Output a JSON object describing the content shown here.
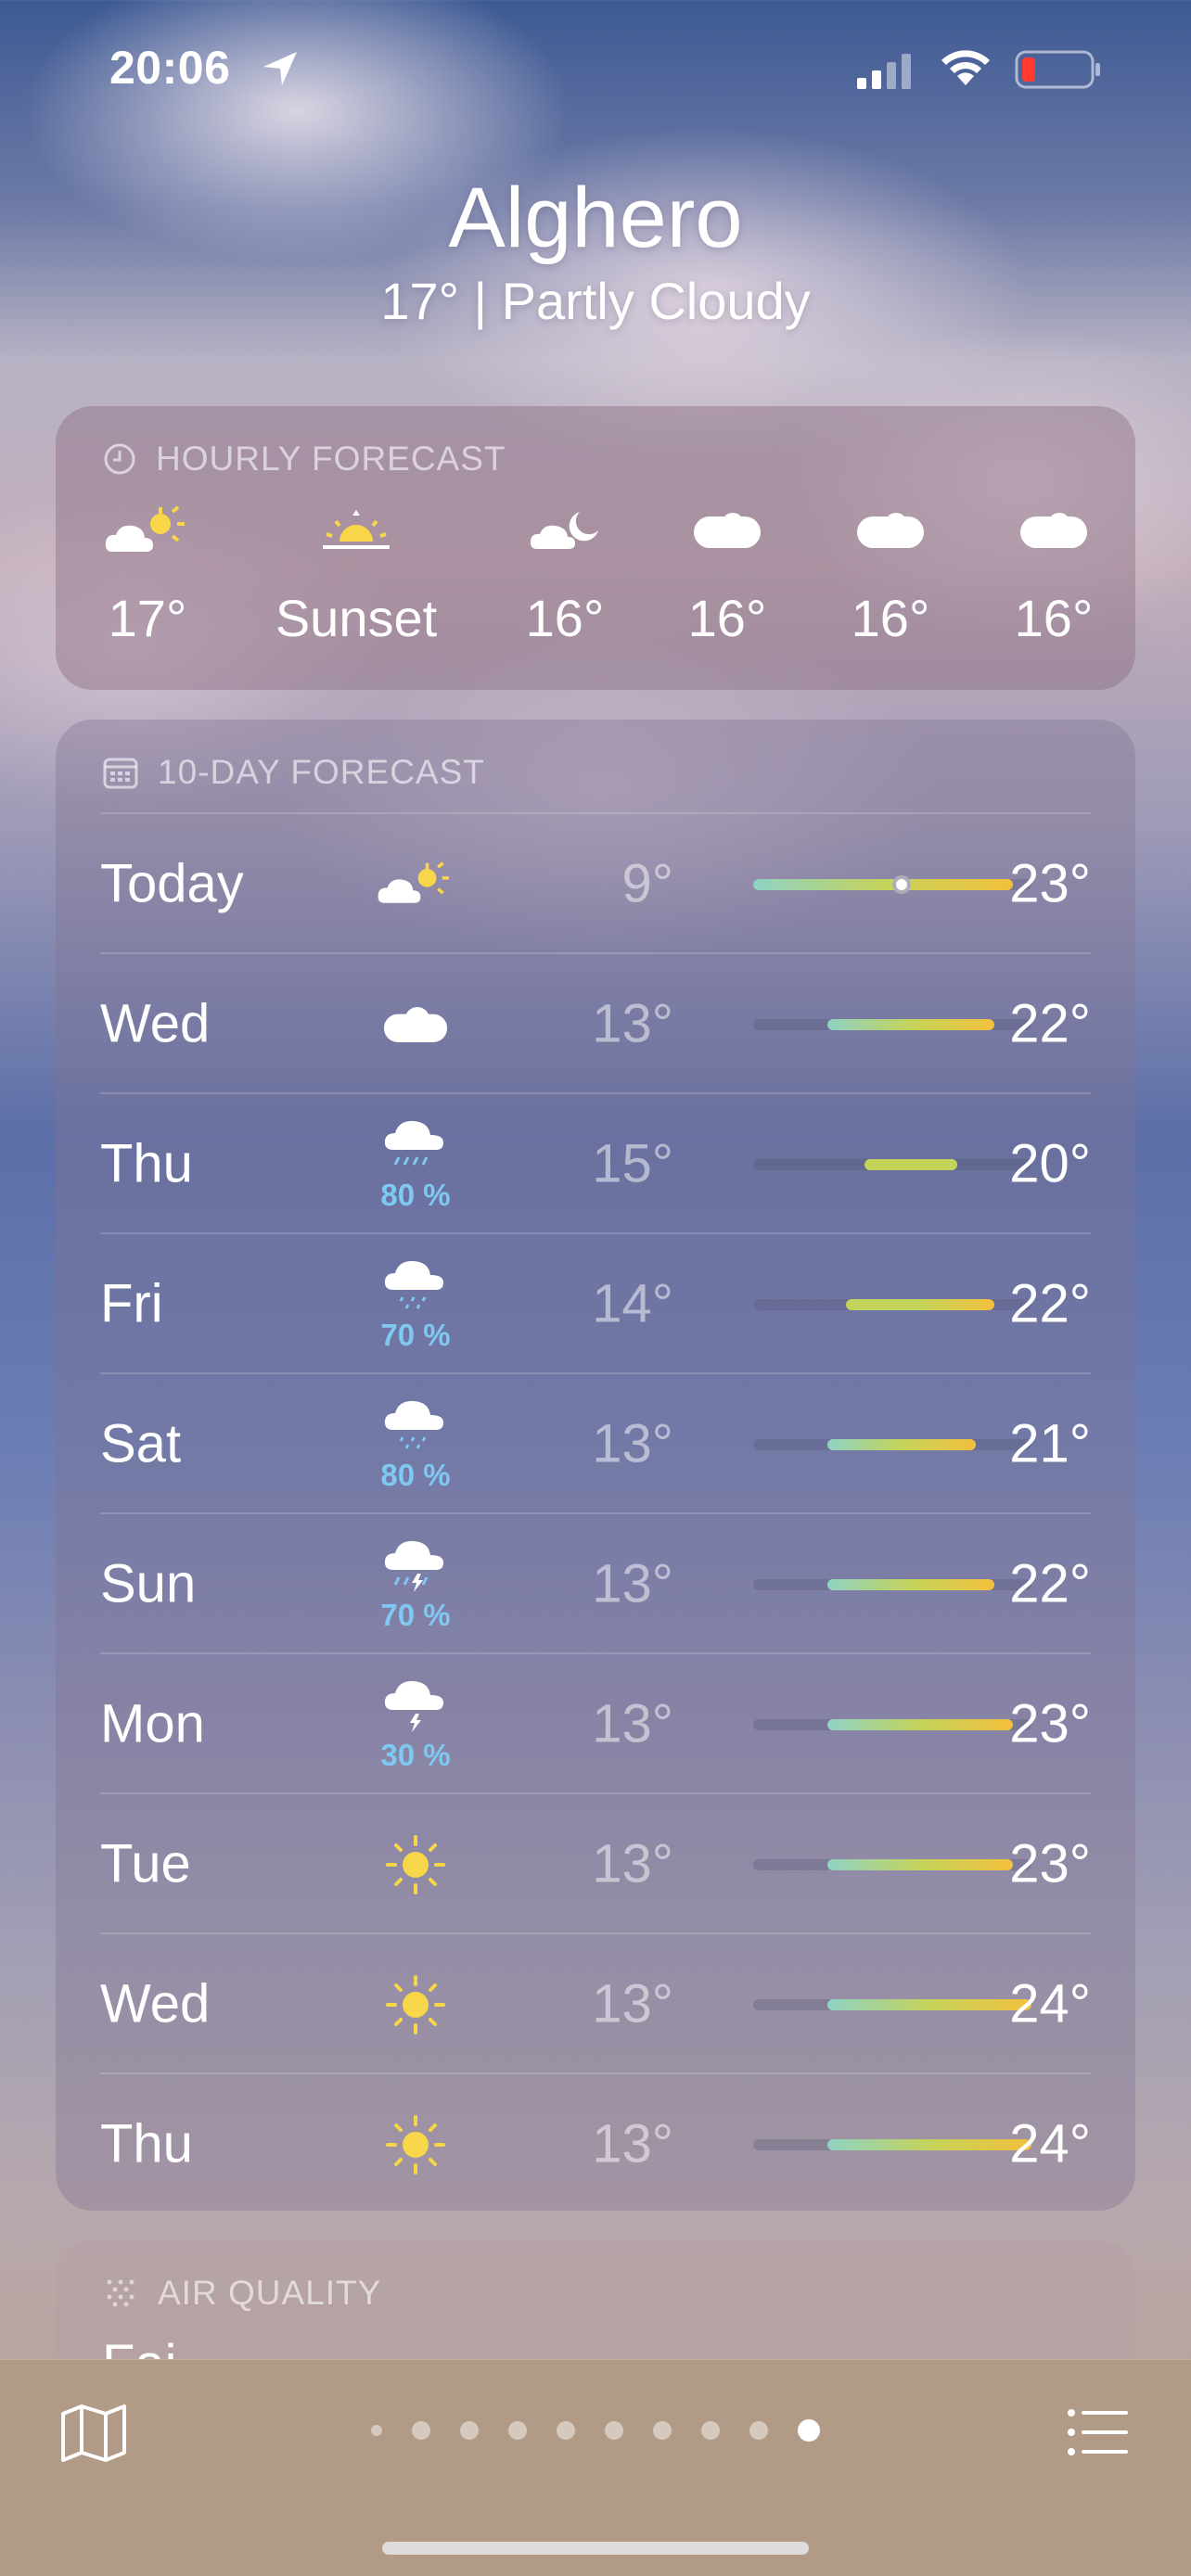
{
  "status_bar": {
    "time": "20:06"
  },
  "location": {
    "city": "Alghero",
    "summary": "17°  |  Partly Cloudy"
  },
  "hourly": {
    "title": "HOURLY FORECAST",
    "items": [
      {
        "temp": "17°",
        "icon": "partly-cloudy-day-icon"
      },
      {
        "temp": "Sunset",
        "icon": "sunset-icon"
      },
      {
        "temp": "16°",
        "icon": "partly-cloudy-night-icon"
      },
      {
        "temp": "16°",
        "icon": "cloud-icon"
      },
      {
        "temp": "16°",
        "icon": "cloud-icon"
      },
      {
        "temp": "16°",
        "icon": "cloud-icon"
      }
    ]
  },
  "daily": {
    "title": "10-DAY FORECAST",
    "range_min": 9,
    "range_max": 24,
    "days": [
      {
        "day": "Today",
        "icon": "partly-cloudy-day-icon",
        "precip": "",
        "low": "9°",
        "high": "23°",
        "low_v": 9,
        "high_v": 23,
        "current_v": 17
      },
      {
        "day": "Wed",
        "icon": "cloud-icon",
        "precip": "",
        "low": "13°",
        "high": "22°",
        "low_v": 13,
        "high_v": 22
      },
      {
        "day": "Thu",
        "icon": "cloud-rain-icon",
        "precip": "80 %",
        "low": "15°",
        "high": "20°",
        "low_v": 15,
        "high_v": 20
      },
      {
        "day": "Fri",
        "icon": "cloud-drizzle-icon",
        "precip": "70 %",
        "low": "14°",
        "high": "22°",
        "low_v": 14,
        "high_v": 22
      },
      {
        "day": "Sat",
        "icon": "cloud-drizzle-icon",
        "precip": "80 %",
        "low": "13°",
        "high": "21°",
        "low_v": 13,
        "high_v": 21
      },
      {
        "day": "Sun",
        "icon": "cloud-bolt-rain-icon",
        "precip": "70 %",
        "low": "13°",
        "high": "22°",
        "low_v": 13,
        "high_v": 22
      },
      {
        "day": "Mon",
        "icon": "cloud-bolt-icon",
        "precip": "30 %",
        "low": "13°",
        "high": "23°",
        "low_v": 13,
        "high_v": 23
      },
      {
        "day": "Tue",
        "icon": "sun-icon",
        "precip": "",
        "low": "13°",
        "high": "23°",
        "low_v": 13,
        "high_v": 23
      },
      {
        "day": "Wed",
        "icon": "sun-icon",
        "precip": "",
        "low": "13°",
        "high": "24°",
        "low_v": 13,
        "high_v": 24
      },
      {
        "day": "Thu",
        "icon": "sun-icon",
        "precip": "",
        "low": "13°",
        "high": "24°",
        "low_v": 13,
        "high_v": 24
      }
    ]
  },
  "air_quality": {
    "title": "AIR QUALITY",
    "peek": "Fai"
  },
  "bottom_bar": {
    "page_count": 10,
    "active_page": 10
  },
  "colors": {
    "precip": "#7ec8f2",
    "sun": "#f7d64a",
    "bar_cool": "#8fd3c4",
    "bar_mid": "#c4d35a",
    "bar_warm": "#f3c03c"
  }
}
